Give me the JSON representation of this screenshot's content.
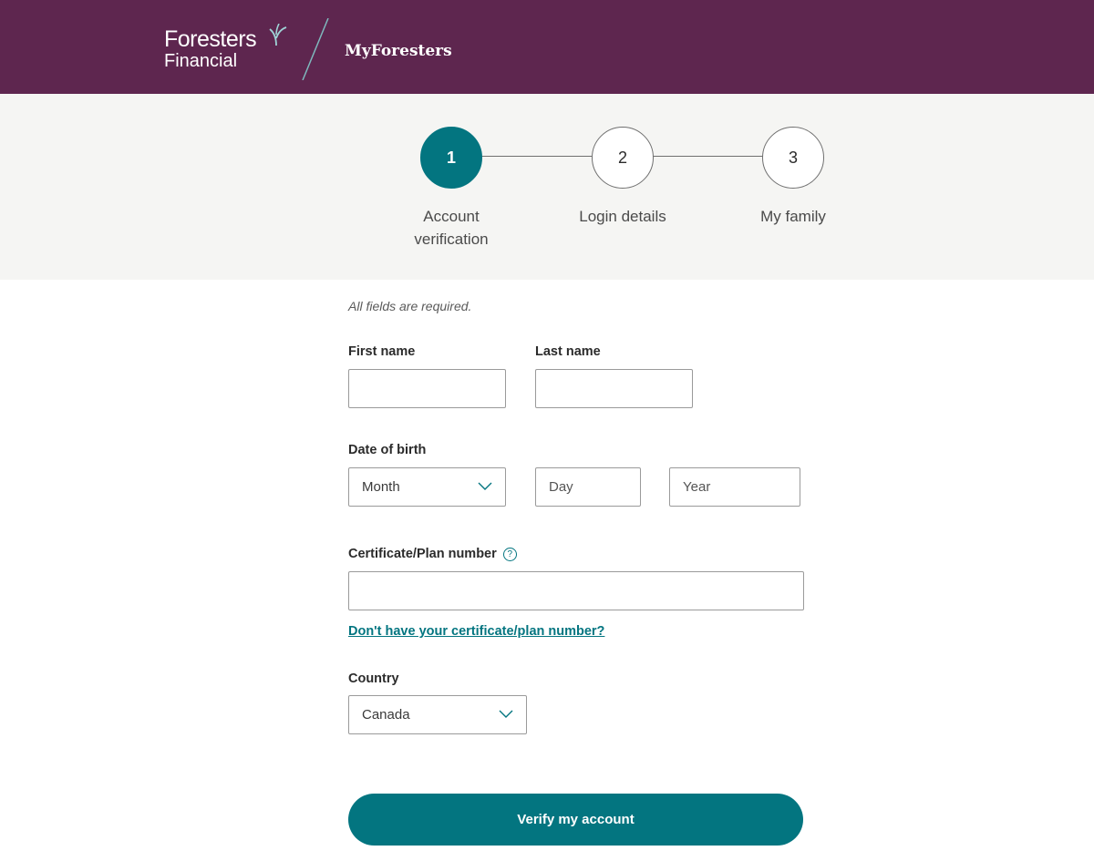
{
  "header": {
    "logo_line1": "Foresters",
    "logo_line2": "Financial",
    "app_name": "MyForesters"
  },
  "stepper": {
    "steps": [
      {
        "number": "1",
        "label": "Account verification",
        "state": "active"
      },
      {
        "number": "2",
        "label": "Login details",
        "state": "inactive"
      },
      {
        "number": "3",
        "label": "My family",
        "state": "inactive"
      }
    ]
  },
  "form": {
    "required_note": "All fields are required.",
    "first_name": {
      "label": "First name",
      "value": "",
      "placeholder": ""
    },
    "last_name": {
      "label": "Last name",
      "value": "",
      "placeholder": ""
    },
    "dob": {
      "label": "Date of birth",
      "month": {
        "value": "Month"
      },
      "day": {
        "placeholder": "Day",
        "value": ""
      },
      "year": {
        "placeholder": "Year",
        "value": ""
      }
    },
    "certificate": {
      "label": "Certificate/Plan number",
      "help_icon": "question-circle-icon",
      "value": "",
      "help_glyph": "?"
    },
    "certificate_link": "Don't have your certificate/plan number?",
    "country": {
      "label": "Country",
      "value": "Canada"
    },
    "submit_label": "Verify my account"
  },
  "colors": {
    "brand_purple": "#5e264f",
    "accent_teal": "#037580",
    "band_grey": "#f5f5f3"
  }
}
